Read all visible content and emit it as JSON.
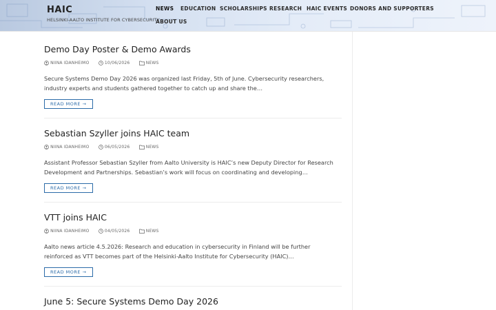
{
  "header": {
    "title": "HAIC",
    "subtitle": "HELSINKI-AALTO INSTITUTE FOR CYBERSECURITY"
  },
  "nav": {
    "items": [
      {
        "label": "NEWS",
        "active": true
      },
      {
        "label": "EDUCATION",
        "active": false
      },
      {
        "label": "SCHOLARSHIPS",
        "active": false
      },
      {
        "label": "RESEARCH",
        "active": false
      },
      {
        "label": "HAIC EVENTS",
        "active": false
      },
      {
        "label": "DONORS AND SUPPORTERS",
        "active": false
      },
      {
        "label": "ABOUT US",
        "active": false
      }
    ]
  },
  "posts": [
    {
      "title": "Demo Day Poster & Demo Awards",
      "author": "NIINA IDANHEIMO",
      "date": "10/06/2026",
      "category": "NEWS",
      "excerpt": "Secure Systems Demo Day 2026 was organized last Friday, 5th of June. Cybersecurity researchers, industry experts and students gathered together to catch up and share the…",
      "read_more": "READ MORE →"
    },
    {
      "title": "Sebastian Szyller joins HAIC team",
      "author": "NIINA IDANHEIMO",
      "date": "06/05/2026",
      "category": "NEWS",
      "excerpt": "Assistant Professor Sebastian Szyller from Aalto University is HAIC’s new Deputy Director for Research Development and Partnerships. Sebastian’s work will focus on coordinating and developing…",
      "read_more": "READ MORE →"
    },
    {
      "title": "VTT joins HAIC",
      "author": "NIINA IDANHEIMO",
      "date": "04/05/2026",
      "category": "NEWS",
      "excerpt": "Aalto news article 4.5.2026: Research and education in cybersecurity in Finland will be further reinforced as VTT becomes part of the Helsinki-Aalto Institute for Cybersecurity (HAIC)…",
      "read_more": "READ MORE →"
    },
    {
      "title": "June 5: Secure Systems Demo Day 2026"
    }
  ],
  "icons": {
    "author": "user-circle-icon",
    "date": "clock-icon",
    "category": "folder-icon",
    "arrow": "arrow-right"
  },
  "colors": {
    "accent": "#2a6aa8",
    "header_bg": "#d3dff0"
  }
}
